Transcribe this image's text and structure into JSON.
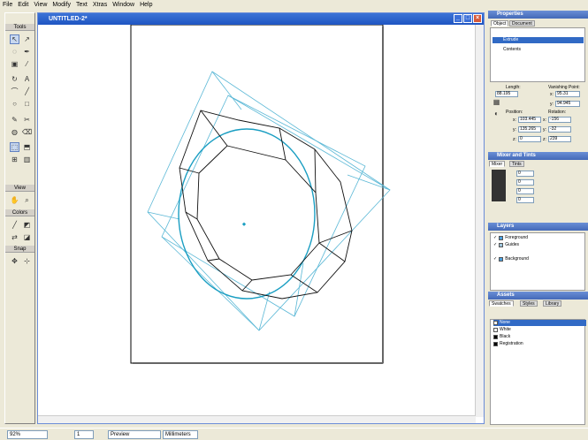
{
  "menu": [
    "File",
    "Edit",
    "View",
    "Modify",
    "Text",
    "Xtras",
    "Window",
    "Help"
  ],
  "toolbox": {
    "sections": [
      "Tools",
      "View",
      "Colors",
      "Snap"
    ],
    "tools": [
      "pointer-icon",
      "subselect-icon",
      "lasso-icon",
      "pen-icon",
      "select-icon",
      "rotate-icon",
      "eyedropper-icon",
      "text-icon",
      "bezigon-icon",
      "line-icon",
      "ellipse-icon",
      "rectangle-icon",
      "freeform-icon",
      "knife-icon",
      "paint-icon",
      "eraser-icon",
      "extrude-icon",
      "perspective-icon",
      "blend-icon",
      "chart-icon",
      "hand-icon",
      "zoom-icon",
      "stroke-color-icon",
      "fill-color-icon",
      "swap-icon",
      "default-icon",
      "snap-point-icon",
      "snap-grid-icon"
    ]
  },
  "document": {
    "title": "UNTITLED-2*"
  },
  "properties": {
    "title": "Properties",
    "tabs": [
      "Object",
      "Document"
    ],
    "tree_items": [
      "Extrude",
      "Contents"
    ],
    "length_label": "Length:",
    "length_value": "88.195",
    "vanishing_label": "Vanishing Point:",
    "vx": "95.31",
    "vy": "94.945",
    "position_label": "Position:",
    "px": "103.445",
    "py": "135.265",
    "pz": "0",
    "rotation_label": "Rotation:",
    "rx": "-156",
    "ry": "-32",
    "rz": "239",
    "x": "x:",
    "y": "y:",
    "z": "z:"
  },
  "mixer": {
    "title": "Mixer and Tints",
    "tabs": [
      "Mixer",
      "Tints"
    ],
    "values": [
      "0",
      "0",
      "0",
      "0"
    ]
  },
  "layers": {
    "title": "Layers",
    "items": [
      "Foreground",
      "Guides",
      "Background"
    ]
  },
  "assets": {
    "title": "Assets",
    "tabs": [
      "Swatches",
      "Styles",
      "Library"
    ],
    "swatches": [
      {
        "name": "None",
        "color": "#ffffff"
      },
      {
        "name": "White",
        "color": "#ffffff"
      },
      {
        "name": "Black",
        "color": "#000000"
      },
      {
        "name": "Registration",
        "color": "#000000"
      }
    ]
  },
  "status": {
    "zoom": "92%",
    "page": "1",
    "view_mode": "Preview",
    "units": "Millimeters"
  },
  "colors": {
    "titlebar": "#1f55c2",
    "guide": "#5bb8d6",
    "selection": "#316ac5"
  }
}
